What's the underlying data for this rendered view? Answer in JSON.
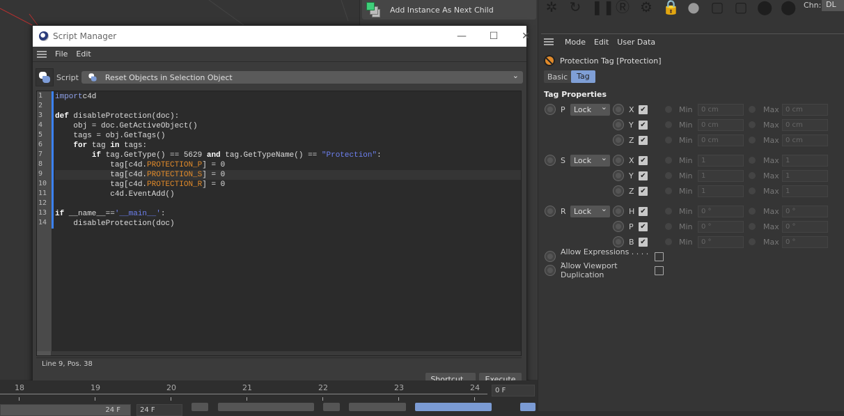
{
  "top_bar": {
    "add_instance_label": "Add Instance As Next Child",
    "channel_label": "Chn:",
    "channel_value": "DL"
  },
  "toolbar_icons": [
    "xpresso-icon",
    "refresh-icon",
    "pause-icon",
    "render-icon",
    "gear-icon",
    "lock-icon",
    "material-sphere-icon",
    "frame-icon",
    "frame2-icon",
    "f-marker-icon",
    "m-marker-icon"
  ],
  "script_manager": {
    "title": "Script Manager",
    "menu": [
      "File",
      "Edit"
    ],
    "script_label": "Script",
    "script_selected": "Reset Objects in Selection Object",
    "current_line": 9,
    "code": [
      [
        [
          "kw2",
          "import"
        ],
        [
          "",
          "c4d"
        ]
      ],
      [],
      [
        [
          "kw",
          "def"
        ],
        [
          "",
          " disableProtection(doc):"
        ]
      ],
      [
        [
          "",
          "    obj = doc.GetActiveObject()"
        ]
      ],
      [
        [
          "",
          "    tags = obj.GetTags()"
        ]
      ],
      [
        [
          "",
          "    "
        ],
        [
          "kw",
          "for"
        ],
        [
          "",
          " tag "
        ],
        [
          "kw",
          "in"
        ],
        [
          "",
          " tags:"
        ]
      ],
      [
        [
          "",
          "        "
        ],
        [
          "kw",
          "if"
        ],
        [
          "",
          " tag.GetType() == 5629 "
        ],
        [
          "kw",
          "and"
        ],
        [
          "",
          " tag.GetTypeName() == "
        ],
        [
          "str",
          "\"Protection\""
        ],
        [
          "",
          ":"
        ]
      ],
      [
        [
          "",
          "            tag[c4d."
        ],
        [
          "const",
          "PROTECTION_P"
        ],
        [
          "",
          "] = 0"
        ]
      ],
      [
        [
          "",
          "            tag[c4d."
        ],
        [
          "const",
          "PROTECTION_S"
        ],
        [
          "",
          "] = 0"
        ]
      ],
      [
        [
          "",
          "            tag[c4d."
        ],
        [
          "const",
          "PROTECTION_R"
        ],
        [
          "",
          "] = 0"
        ]
      ],
      [
        [
          "",
          "            c4d.EventAdd()"
        ]
      ],
      [],
      [
        [
          "kw",
          "if"
        ],
        [
          "",
          " __name__=="
        ],
        [
          "str",
          "'__main__'"
        ],
        [
          "",
          ":"
        ]
      ],
      [
        [
          "",
          "    disableProtection(doc)"
        ]
      ]
    ],
    "status": "Line 9, Pos. 38",
    "shortcut_label": "Shortcut...",
    "execute_label": "Execute"
  },
  "timeline": {
    "ticks": [
      "18",
      "19",
      "20",
      "21",
      "22",
      "23",
      "24"
    ],
    "frame_field": "0 F",
    "end_field": "24 F",
    "end_field2": "24 F"
  },
  "attributes": {
    "menu": [
      "Mode",
      "Edit",
      "User Data"
    ],
    "object_title": "Protection Tag [Protection]",
    "tabs": [
      {
        "label": "Basic",
        "active": false
      },
      {
        "label": "Tag",
        "active": true
      }
    ],
    "section": "Tag Properties",
    "groups": [
      {
        "name": "P",
        "mode": "Lock",
        "axes": [
          {
            "axis": "X",
            "checked": true,
            "min": "0 cm",
            "max": "0 cm"
          },
          {
            "axis": "Y",
            "checked": true,
            "min": "0 cm",
            "max": "0 cm"
          },
          {
            "axis": "Z",
            "checked": true,
            "min": "0 cm",
            "max": "0 cm"
          }
        ]
      },
      {
        "name": "S",
        "mode": "Lock",
        "axes": [
          {
            "axis": "X",
            "checked": true,
            "min": "1",
            "max": "1"
          },
          {
            "axis": "Y",
            "checked": true,
            "min": "1",
            "max": "1"
          },
          {
            "axis": "Z",
            "checked": true,
            "min": "1",
            "max": "1"
          }
        ]
      },
      {
        "name": "R",
        "mode": "Lock",
        "axes": [
          {
            "axis": "H",
            "checked": true,
            "min": "0 °",
            "max": "0 °"
          },
          {
            "axis": "P",
            "checked": true,
            "min": "0 °",
            "max": "0 °"
          },
          {
            "axis": "B",
            "checked": true,
            "min": "0 °",
            "max": "0 °"
          }
        ]
      }
    ],
    "min_label": "Min",
    "max_label": "Max",
    "allow_expressions": {
      "label": "Allow Expressions . . . . . .",
      "checked": false
    },
    "allow_viewport_duplication": {
      "label": "Allow Viewport Duplication",
      "checked": false
    }
  },
  "colors": {
    "accent": "#3b82f6",
    "tab_active": "#7f9fd6",
    "constant": "#e08a2a",
    "string": "#6d80f0"
  }
}
